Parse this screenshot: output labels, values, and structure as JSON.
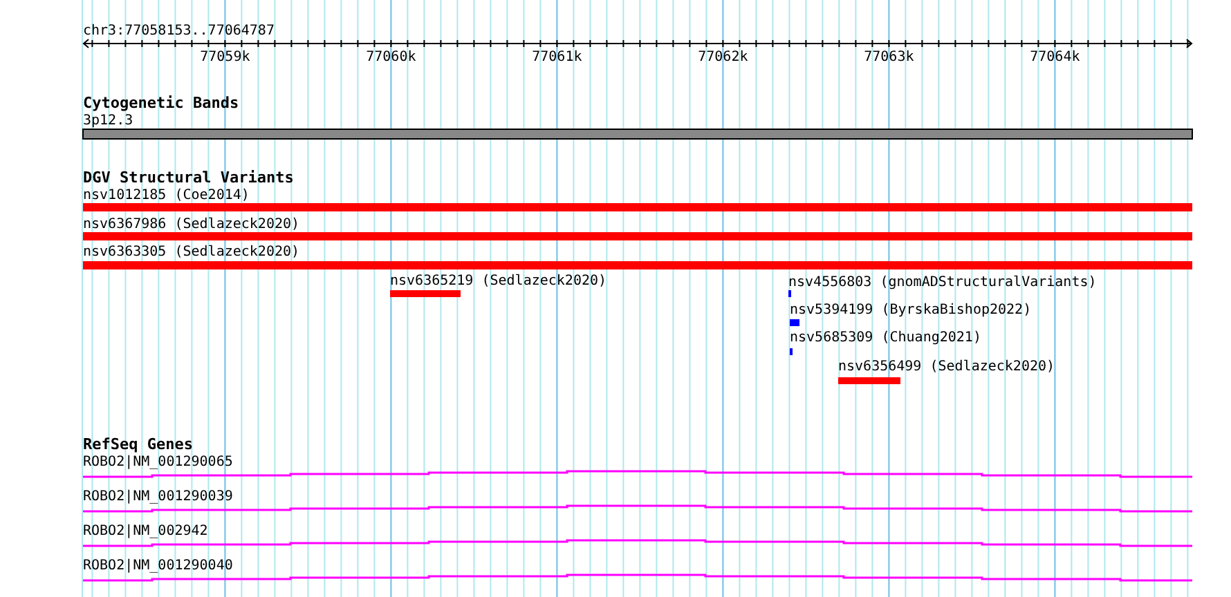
{
  "ruler": {
    "location": "chr3:77058153..77064787",
    "ticks": [
      "77059k",
      "77060k",
      "77061k",
      "77062k",
      "77063k",
      "77064k"
    ]
  },
  "tracks": [
    {
      "kind": "bands",
      "title": "Cytogenetic Bands",
      "features": [
        {
          "label": "3p12.3"
        }
      ]
    },
    {
      "kind": "variants",
      "title": "DGV Structural Variants",
      "features": [
        {
          "label": "nsv1012185 (Coe2014)",
          "color": "#ff0000"
        },
        {
          "label": "nsv6367986 (Sedlazeck2020)",
          "color": "#ff0000"
        },
        {
          "label": "nsv6363305 (Sedlazeck2020)",
          "color": "#ff0000"
        },
        {
          "label": "nsv6365219 (Sedlazeck2020)",
          "color": "#ff0000"
        },
        {
          "label": "nsv4556803 (gnomADStructuralVariants)",
          "color": "#0000ff"
        },
        {
          "label": "nsv5394199 (ByrskaBishop2022)",
          "color": "#0000ff"
        },
        {
          "label": "nsv5685309 (Chuang2021)",
          "color": "#0000ff"
        },
        {
          "label": "nsv6356499 (Sedlazeck2020)",
          "color": "#ff0000"
        }
      ]
    },
    {
      "kind": "genes",
      "title": "RefSeq Genes",
      "features": [
        {
          "label": "ROBO2|NM_001290065"
        },
        {
          "label": "ROBO2|NM_001290039"
        },
        {
          "label": "ROBO2|NM_002942"
        },
        {
          "label": "ROBO2|NM_001290040"
        }
      ]
    }
  ]
}
